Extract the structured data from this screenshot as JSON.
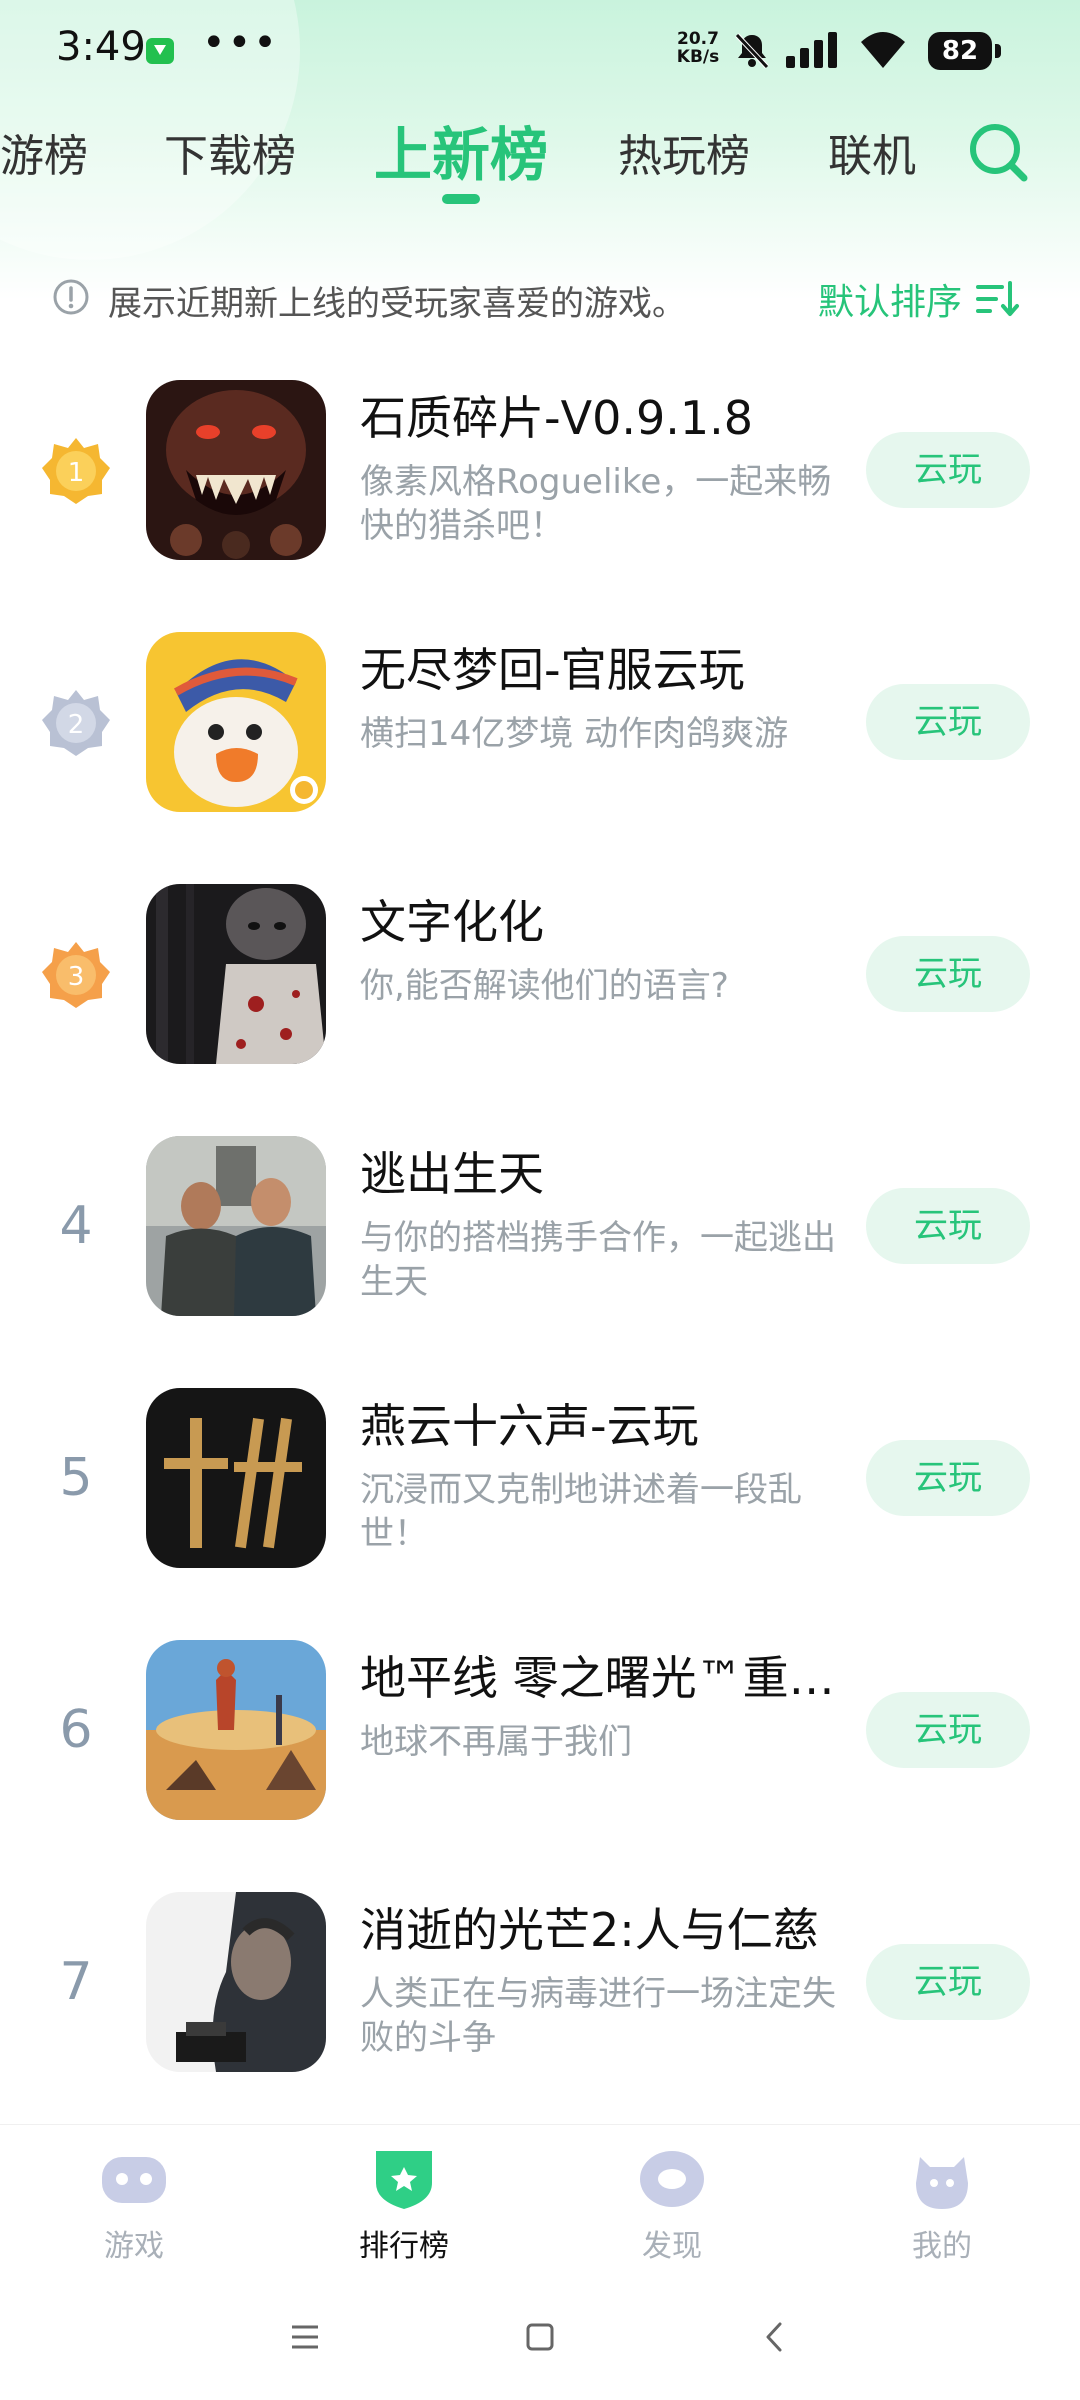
{
  "status_bar": {
    "time": "3:49",
    "dots": "•••",
    "net_speed_value": "20.7",
    "net_speed_unit": "KB/s",
    "battery": "82"
  },
  "tabs": [
    {
      "label": "游戏榜",
      "display": "游榜",
      "active": false
    },
    {
      "label": "下载榜",
      "active": false
    },
    {
      "label": "上新榜",
      "active": true
    },
    {
      "label": "热玩榜",
      "active": false
    },
    {
      "label": "联机",
      "active": false
    }
  ],
  "info": {
    "text": "展示近期新上线的受玩家喜爱的游戏。",
    "sort_label": "默认排序"
  },
  "games": [
    {
      "rank": "1",
      "title": "石质碎片-V0.9.1.8",
      "desc": "像素风格Roguelike，一起来畅快的猎杀吧！",
      "button": "云玩",
      "icon": "monster-game-icon"
    },
    {
      "rank": "2",
      "title": "无尽梦回-官服云玩",
      "desc": "横扫14亿梦境 动作肉鸽爽游",
      "button": "云玩",
      "icon": "duck-game-icon"
    },
    {
      "rank": "3",
      "title": "文字化化",
      "desc": "你,能否解读他们的语言?",
      "button": "云玩",
      "icon": "horror-game-icon"
    },
    {
      "rank": "4",
      "title": "逃出生天",
      "desc": "与你的搭档携手合作，一起逃出生天",
      "button": "云玩",
      "icon": "escape-game-icon"
    },
    {
      "rank": "5",
      "title": "燕云十六声-云玩",
      "desc": "沉浸而又克制地讲述着一段乱世！",
      "button": "云玩",
      "icon": "brush-logo-game-icon"
    },
    {
      "rank": "6",
      "title": "地平线 零之曙光™重制版",
      "desc": "地球不再属于我们",
      "button": "云玩",
      "icon": "horizon-game-icon"
    },
    {
      "rank": "7",
      "title": "消逝的光芒2:人与仁慈",
      "desc": "人类正在与病毒进行一场注定失败的斗争",
      "button": "云玩",
      "icon": "dying-light-game-icon"
    }
  ],
  "bottom_nav": [
    {
      "label": "游戏",
      "icon": "gamepad-icon",
      "active": false
    },
    {
      "label": "排行榜",
      "icon": "ranking-shield-icon",
      "active": true
    },
    {
      "label": "发现",
      "icon": "discover-eye-icon",
      "active": false
    },
    {
      "label": "我的",
      "icon": "profile-mascot-icon",
      "active": false
    }
  ],
  "colors": {
    "accent": "#27c47a",
    "gold": "#f5b731",
    "silver": "#b9c1d4",
    "bronze": "#f5a04a",
    "button_bg": "#e6f7ee"
  }
}
